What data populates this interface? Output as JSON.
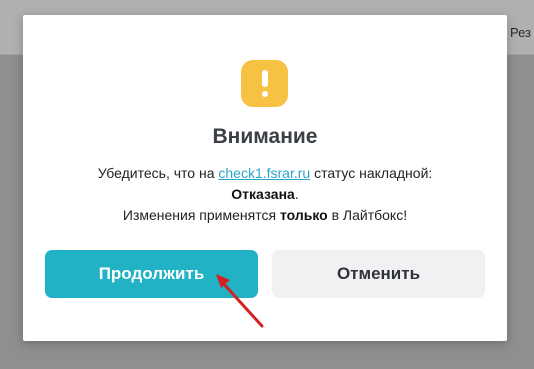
{
  "background": {
    "tab_label": "Рез"
  },
  "dialog": {
    "icon": "warning-exclamation-icon",
    "title": "Внимание",
    "message": {
      "line1_prefix": "Убедитесь, что на ",
      "link_text": "check1.fsrar.ru",
      "line1_suffix": " статус накладной:",
      "status_value": "Отказана",
      "status_period": ".",
      "line3_prefix": "Изменения применятся ",
      "line3_bold": "только",
      "line3_suffix": " в Лайтбокс!"
    },
    "buttons": {
      "continue_label": "Продолжить",
      "cancel_label": "Отменить"
    }
  },
  "colors": {
    "accent": "#22b2c6",
    "warning": "#f7c244",
    "annotation_arrow": "#d42020"
  }
}
